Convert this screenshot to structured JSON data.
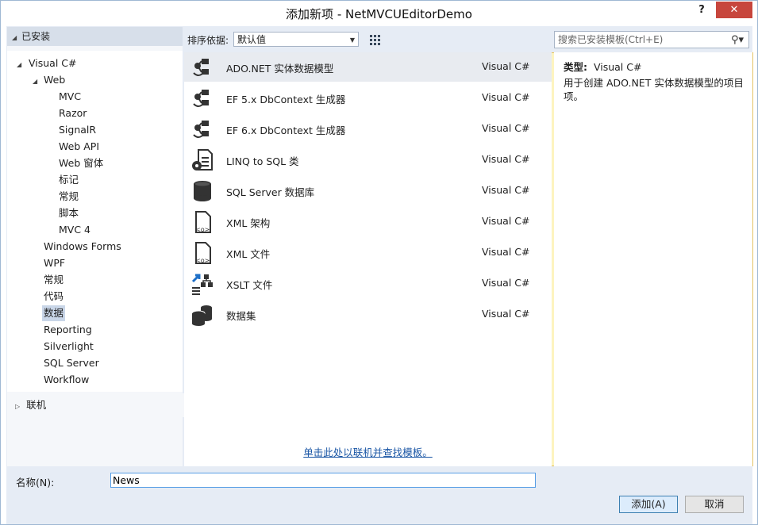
{
  "window": {
    "title": "添加新项 - NetMVCUEditorDemo",
    "help": "?",
    "close": "✕"
  },
  "left": {
    "installed_header": "已安装",
    "tree": [
      {
        "label": "Visual C#"
      },
      {
        "label": "Web"
      },
      {
        "label": "MVC"
      },
      {
        "label": "Razor"
      },
      {
        "label": "SignalR"
      },
      {
        "label": "Web API"
      },
      {
        "label": "Web 窗体"
      },
      {
        "label": "标记"
      },
      {
        "label": "常规"
      },
      {
        "label": "脚本"
      },
      {
        "label": "MVC 4"
      },
      {
        "label": "Windows Forms"
      },
      {
        "label": "WPF"
      },
      {
        "label": "常规"
      },
      {
        "label": "代码"
      },
      {
        "label": "数据",
        "selected": true
      },
      {
        "label": "Reporting"
      },
      {
        "label": "Silverlight"
      },
      {
        "label": "SQL Server"
      },
      {
        "label": "Workflow"
      }
    ],
    "online_header": "联机"
  },
  "toolbar": {
    "sort_label": "排序依据:",
    "sort_value": "默认值",
    "search_placeholder": "搜索已安装模板(Ctrl+E)"
  },
  "templates": [
    {
      "name": "ADO.NET 实体数据模型",
      "lang": "Visual C#",
      "icon": "entity-model-icon",
      "selected": true
    },
    {
      "name": "EF 5.x DbContext 生成器",
      "lang": "Visual C#",
      "icon": "dbcontext-generator-icon"
    },
    {
      "name": "EF 6.x DbContext 生成器",
      "lang": "Visual C#",
      "icon": "dbcontext-generator-icon"
    },
    {
      "name": "LINQ to SQL 类",
      "lang": "Visual C#",
      "icon": "linq-to-sql-icon"
    },
    {
      "name": "SQL Server 数据库",
      "lang": "Visual C#",
      "icon": "database-icon"
    },
    {
      "name": "XML 架构",
      "lang": "Visual C#",
      "icon": "xml-schema-icon"
    },
    {
      "name": "XML 文件",
      "lang": "Visual C#",
      "icon": "xml-file-icon"
    },
    {
      "name": "XSLT 文件",
      "lang": "Visual C#",
      "icon": "xslt-file-icon"
    },
    {
      "name": "数据集",
      "lang": "Visual C#",
      "icon": "dataset-icon"
    }
  ],
  "online_link": "单击此处以联机并查找模板。",
  "details": {
    "type_label": "类型:",
    "type_value": "Visual C#",
    "description": "用于创建 ADO.NET 实体数据模型的项目项。"
  },
  "bottom": {
    "name_label": "名称(N):",
    "name_value": "News",
    "add_label": "添加(A)",
    "cancel_label": "取消"
  },
  "colors": {
    "accent": "#1a56a5",
    "close": "#c7463d",
    "panel": "#e6ecf5"
  }
}
